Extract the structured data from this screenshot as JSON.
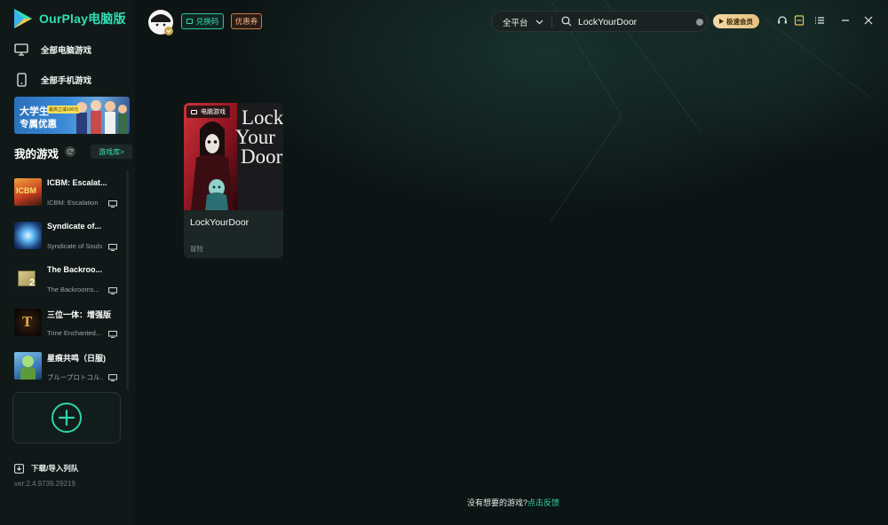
{
  "app": {
    "name": "OurPlay电脑版",
    "version": "ver:2.4.9739.29219",
    "accent": "#2fe0b6"
  },
  "sidebar": {
    "nav": [
      {
        "label": "全部电脑游戏",
        "icon": "monitor-icon"
      },
      {
        "label": "全部手机游戏",
        "icon": "phone-icon"
      }
    ],
    "banner": {
      "line1": "大学生",
      "line2": "专属优惠",
      "tag": "最高立减100元"
    },
    "my_games": {
      "title": "我的游戏",
      "library_label": "游戏库>",
      "items": [
        {
          "name": "ICBM: Escalat...",
          "sub": "ICBM: Escalation",
          "thumb_text": "ICBM"
        },
        {
          "name": "Syndicate of...",
          "sub": "Syndicate of Souls",
          "thumb_text": ""
        },
        {
          "name": "The Backroo...",
          "sub": "The Backrooms...",
          "thumb_text": "2"
        },
        {
          "name": "三位一体：增强版",
          "sub": "Trine Enchanted...",
          "thumb_text": "T"
        },
        {
          "name": "星痕共鸣（日服)",
          "sub": "ブループロトコル...",
          "thumb_text": ""
        }
      ]
    },
    "download_label": "下载/导入列队"
  },
  "header": {
    "redeem_label": "兑换码",
    "coupon_label": "优惠券",
    "search": {
      "platform": "全平台",
      "value": "LockYourDoor"
    },
    "vip_label": "极速会员"
  },
  "results": [
    {
      "title": "LockYourDoor",
      "tag": "电脑游戏",
      "genre": "冒险",
      "art_text": [
        "Lock",
        "Your",
        "Door"
      ]
    }
  ],
  "footer": {
    "text": "没有想要的游戏?",
    "link": "点击反馈"
  }
}
